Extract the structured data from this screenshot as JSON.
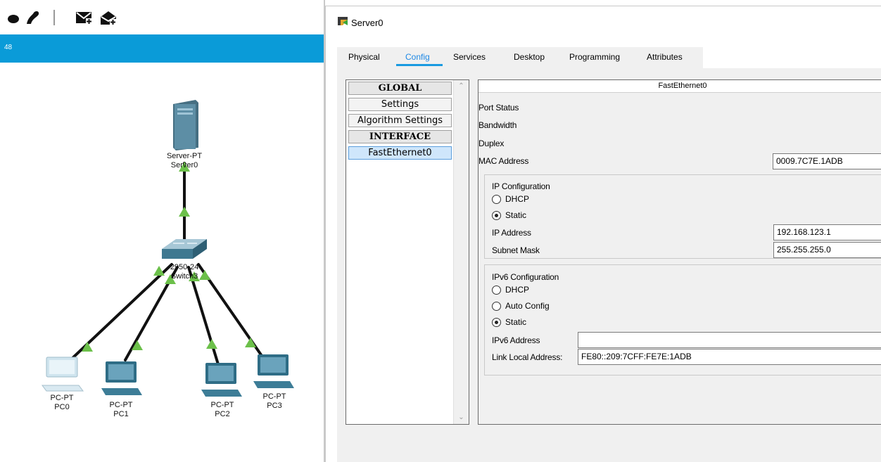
{
  "workspace": {
    "bar_text": "48",
    "devices": {
      "server": {
        "type": "Server-PT",
        "name": "Server0"
      },
      "switch": {
        "type": "2950-24",
        "name": "Switch3"
      },
      "pc0": {
        "type": "PC-PT",
        "name": "PC0"
      },
      "pc1": {
        "type": "PC-PT",
        "name": "PC1"
      },
      "pc2": {
        "type": "PC-PT",
        "name": "PC2"
      },
      "pc3": {
        "type": "PC-PT",
        "name": "PC3"
      }
    }
  },
  "dialog": {
    "title": "Server0",
    "tabs": [
      {
        "label": "Physical",
        "active": false
      },
      {
        "label": "Config",
        "active": true
      },
      {
        "label": "Services",
        "active": false
      },
      {
        "label": "Desktop",
        "active": false
      },
      {
        "label": "Programming",
        "active": false
      },
      {
        "label": "Attributes",
        "active": false
      }
    ],
    "sidebar": {
      "items": [
        {
          "label": "GLOBAL",
          "kind": "header"
        },
        {
          "label": "Settings",
          "kind": "item"
        },
        {
          "label": "Algorithm Settings",
          "kind": "item"
        },
        {
          "label": "INTERFACE",
          "kind": "header"
        },
        {
          "label": "FastEthernet0",
          "kind": "item",
          "selected": true
        }
      ]
    },
    "interface": {
      "name": "FastEthernet0",
      "port_status_label": "Port Status",
      "bandwidth_label": "Bandwidth",
      "duplex_label": "Duplex",
      "mac_label": "MAC Address",
      "mac_value": "0009.7C7E.1ADB",
      "ipv4": {
        "title": "IP Configuration",
        "dhcp_label": "DHCP",
        "static_label": "Static",
        "mode": "Static",
        "ip_label": "IP Address",
        "ip_value": "192.168.123.1",
        "mask_label": "Subnet Mask",
        "mask_value": "255.255.255.0"
      },
      "ipv6": {
        "title": "IPv6 Configuration",
        "dhcp_label": "DHCP",
        "auto_label": "Auto Config",
        "static_label": "Static",
        "mode": "Static",
        "address_label": "IPv6 Address",
        "address_value": "",
        "link_local_label": "Link Local Address:",
        "link_local_value": "FE80::209:7CFF:FE7E:1ADB"
      }
    }
  },
  "colors": {
    "workspace_bar": "#0a9bd8",
    "link_indicator": "#6cc04a",
    "tab_accent": "#1a9ae0"
  }
}
